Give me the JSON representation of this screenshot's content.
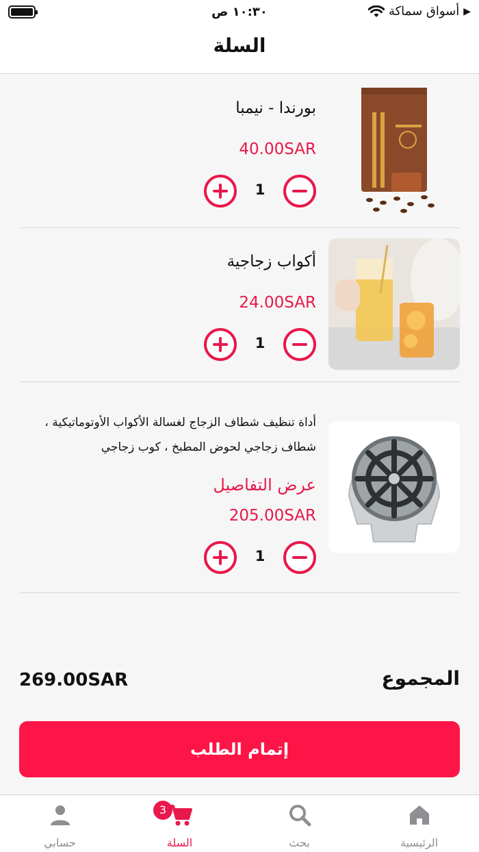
{
  "status_bar": {
    "time": "١٠:٣٠ ص",
    "carrier": "أسواق سماكة",
    "battery_icon": "battery-icon",
    "wifi_icon": "wifi-icon"
  },
  "header": {
    "title": "السلة"
  },
  "cart_items": [
    {
      "name": "بورندا - نيمبا",
      "price": "40.00SAR",
      "quantity": "1",
      "image_icon": "coffee-bag-image"
    },
    {
      "name": "أكواب زجاجية",
      "price": "24.00SAR",
      "quantity": "1",
      "image_icon": "glass-cups-image"
    },
    {
      "name_line1": "أداة تنظيف شطاف الزجاج لغسالة الأكواب الأوتوماتيكية ،",
      "name_line2": "شطاف زجاجي لحوض المطبخ ، كوب زجاجي",
      "details_link": "عرض التفاصيل",
      "price": "205.00SAR",
      "quantity": "1",
      "image_icon": "glass-rinser-image"
    }
  ],
  "total": {
    "label": "المجموع",
    "amount": "269.00SAR"
  },
  "checkout": {
    "label": "إتمام الطلب"
  },
  "tab_bar": {
    "home": "الرئيسية",
    "search": "بحث",
    "cart": "السلة",
    "account": "حسابي",
    "cart_badge": "3"
  },
  "colors": {
    "accent": "#e8184a",
    "button": "#fc1546",
    "inactive": "#8e8e93"
  }
}
